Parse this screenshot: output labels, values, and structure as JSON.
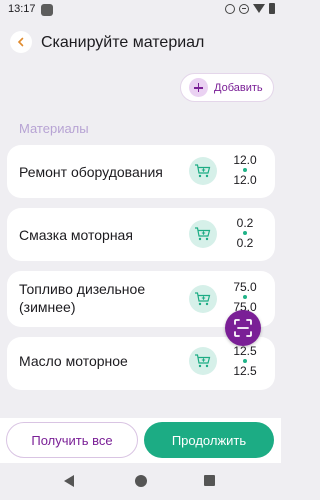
{
  "status_bar": {
    "time": "13:17"
  },
  "header": {
    "title": "Сканируйте материал"
  },
  "add_button": {
    "label": "Добавить"
  },
  "section": {
    "label": "Материалы"
  },
  "materials": [
    {
      "name": "Ремонт оборудования",
      "qty_top": "12.0",
      "qty_bottom": "12.0"
    },
    {
      "name": "Смазка моторная",
      "qty_top": "0.2",
      "qty_bottom": "0.2"
    },
    {
      "name": "Топливо дизельное (зимнее)",
      "qty_top": "75.0",
      "qty_bottom": "75.0"
    },
    {
      "name": "Масло моторное",
      "qty_top": "12.5",
      "qty_bottom": "12.5"
    }
  ],
  "buttons": {
    "get_all": "Получить все",
    "continue": "Продолжить"
  },
  "colors": {
    "accent": "#7a1f96",
    "primary": "#1cac84",
    "background": "#efeef2"
  },
  "icons": {
    "back": "arrow-left-icon",
    "cart": "cart-icon",
    "scan": "scan-icon",
    "add": "plus-icon"
  }
}
